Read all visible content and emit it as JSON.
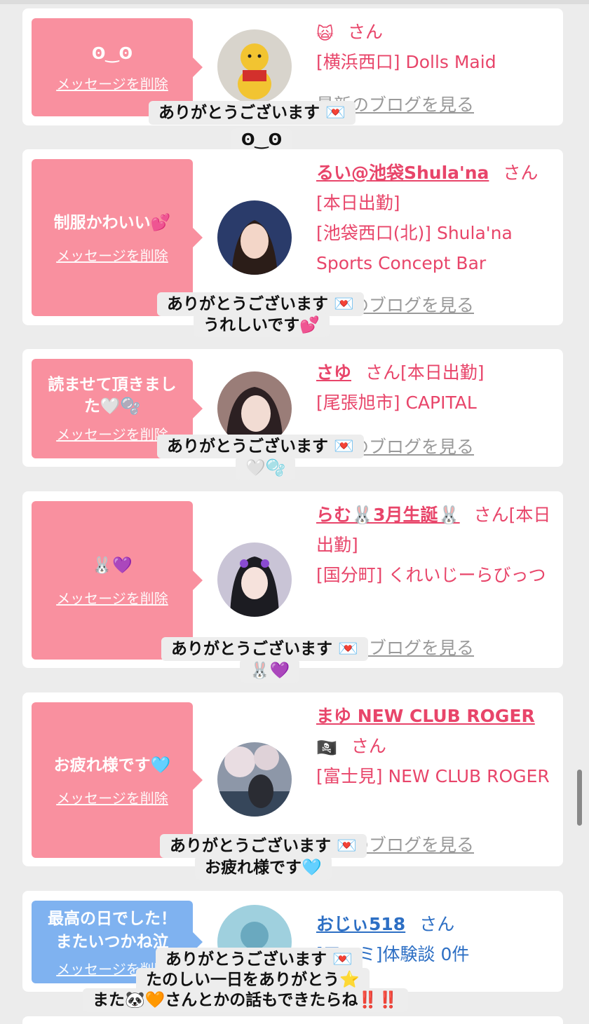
{
  "common": {
    "delete_label": "メッセージを削除",
    "blog_label": "最新のブログを見る",
    "san": "さん",
    "thanks": "ありがとうございます"
  },
  "cards": [
    {
      "message": "ʘ‿ʘ",
      "name_emoji": "🙀",
      "shop": "[横浜西口] Dolls Maid",
      "reply": "ʘ‿ʘ"
    },
    {
      "message": "制服かわいい💕",
      "name": "るい@池袋Shula'na",
      "status": "[本日出勤]",
      "shop": "[池袋西口(北)] Shula'na Sports Concept Bar",
      "reply": "うれしいです💕"
    },
    {
      "message": "読ませて頂きました🤍🫧",
      "name": "さゆ",
      "status": "[本日出勤]",
      "shop": "[尾張旭市] CAPITAL",
      "reply": "🤍🫧"
    },
    {
      "message": "🐰💜",
      "name": "らむ🐰3月生誕🐰",
      "status": "[本日出勤]",
      "shop": "[国分町] くれいじーらびっつ",
      "reply": "🐰💜"
    },
    {
      "message": "お疲れ様です🩵",
      "name": "まゆ NEW CLUB ROGER",
      "name_emoji": "🏴‍☠️",
      "shop": "[富士見] NEW CLUB ROGER",
      "reply": "お疲れ様です🩵"
    },
    {
      "message": "最高の日でした！またいつかね泣",
      "name": "おじぃ518",
      "shop": "[口コミ]体験談 0件",
      "reply_line2": "たのしい一日をありがとう⭐️",
      "reply_line3": "また🐼🧡さんとかの話もできたらね‼️‼️"
    }
  ]
}
